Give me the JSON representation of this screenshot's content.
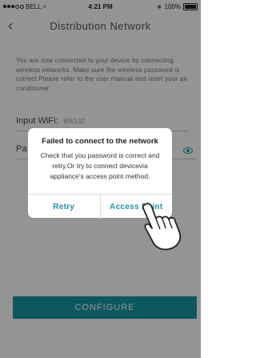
{
  "status_bar": {
    "carrier": "BELL",
    "time": "4:21 PM",
    "battery_percent": "100%"
  },
  "header": {
    "back_icon": "chevron-left-icon",
    "title": "Distribution Network"
  },
  "intro_text": "You are now connected to your device by connecting wireless networks. Make sure the wireless password is correct.Please refer to the user manual and reset your air conditioner",
  "fields": {
    "wifi_label": "Input WiFi:",
    "wifi_value": "BW13Z",
    "password_label": "Pa"
  },
  "configure_label": "CONFIGURE",
  "dialog": {
    "title": "Failed to connect to the network",
    "message": "Check that you password is correct and retry.Or try to connect devicevia appliance's access point method.",
    "retry_label": "Retry",
    "access_point_label": "Access Point"
  },
  "colors": {
    "accent": "#1796a8"
  }
}
